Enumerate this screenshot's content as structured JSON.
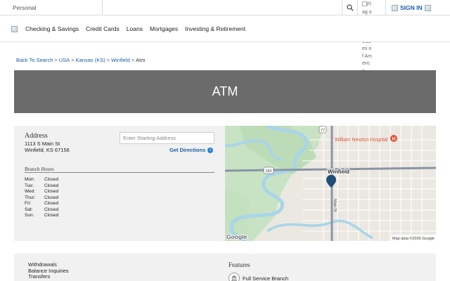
{
  "topbar": {
    "segment": "Personal",
    "flag_alt": "Flag of the United States of America",
    "sign_in": "SIGN IN"
  },
  "nav": {
    "items": [
      "Checking & Savings",
      "Credit Cards",
      "Loans",
      "Mortgages",
      "Investing & Retirement"
    ]
  },
  "breadcrumb": {
    "links": [
      "Back To Search",
      "USA",
      "Kansas (KS)",
      "Winfield"
    ],
    "current": "Atm",
    "separator": ">"
  },
  "banner": {
    "title": "ATM"
  },
  "address": {
    "title": "Address",
    "line1": "1113 S Main St",
    "line2": "Winfield, KS 67156"
  },
  "directions": {
    "placeholder": "Enter Starting Address",
    "button": "Get Directions"
  },
  "hours": {
    "title": "Branch Hours",
    "rows": [
      {
        "day": "Mon:",
        "value": "Closed"
      },
      {
        "day": "Tue:",
        "value": "Closed"
      },
      {
        "day": "Wed:",
        "value": "Closed"
      },
      {
        "day": "Thur:",
        "value": "Closed"
      },
      {
        "day": "Fri:",
        "value": "Closed"
      },
      {
        "day": "Sat:",
        "value": "Closed"
      },
      {
        "day": "Sun:",
        "value": "Closed"
      }
    ]
  },
  "map": {
    "place_label": "Winfield",
    "poi_label": "William Newton Hospital",
    "poi_marker": "H",
    "road_label": "Main St",
    "shield_1": "160",
    "shield_2": "77",
    "attribution": "Map data ©2026 Google",
    "logo": "Google",
    "colors": {
      "water": "#a9d5e8",
      "park": "#c6e2c2",
      "road": "#8a94a6",
      "pin": "#1f4f78",
      "poi": "#e2563c"
    }
  },
  "services": [
    "Withdrawals",
    "Balance Inquiries",
    "Transfers"
  ],
  "features": {
    "title": "Features",
    "item": "Full Service Branch"
  }
}
